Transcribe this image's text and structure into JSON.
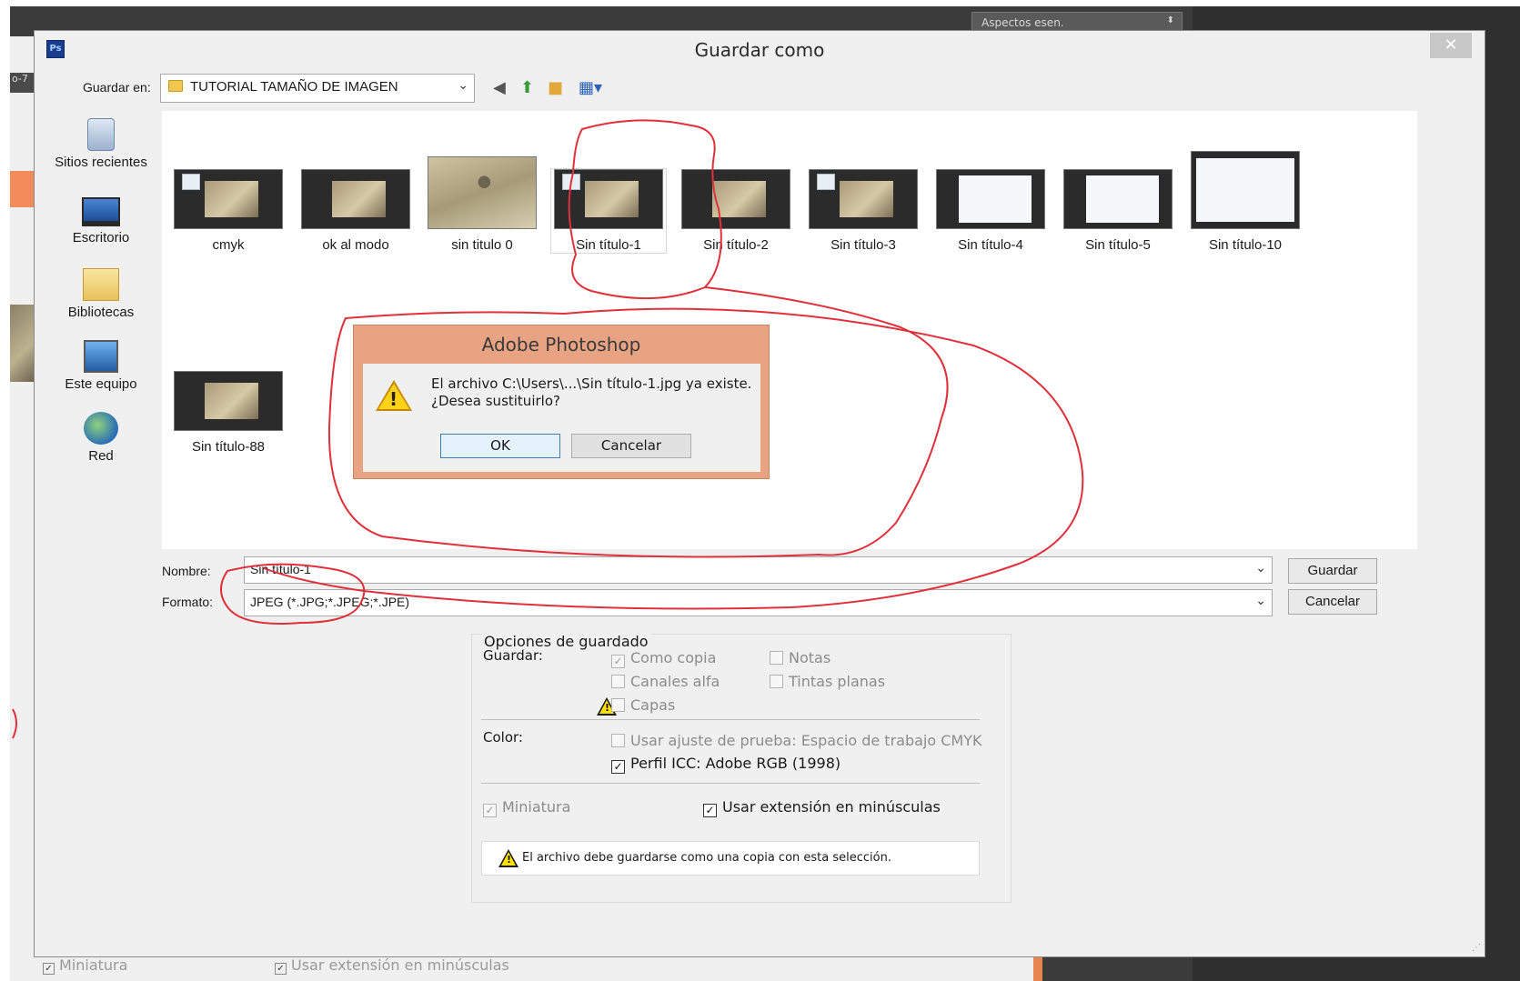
{
  "background": {
    "tab_label": "o-7",
    "top_select": "Aspectos esen.",
    "under_miniatura": "Miniatura",
    "under_extension": "Usar extensión en minúsculas"
  },
  "dialog": {
    "title": "Guardar como",
    "close_glyph": "✕",
    "save_in_label": "Guardar en:",
    "save_in_value": "TUTORIAL TAMAÑO DE IMAGEN"
  },
  "places": [
    {
      "label": "Sitios recientes",
      "icon": "recent-places-icon"
    },
    {
      "label": "Escritorio",
      "icon": "desktop-icon"
    },
    {
      "label": "Bibliotecas",
      "icon": "libraries-icon"
    },
    {
      "label": "Este equipo",
      "icon": "this-pc-icon"
    },
    {
      "label": "Red",
      "icon": "network-icon"
    }
  ],
  "files": [
    {
      "name": "cmyk"
    },
    {
      "name": "ok al modo"
    },
    {
      "name": "sin titulo 0"
    },
    {
      "name": "Sin título-1"
    },
    {
      "name": "Sin título-2"
    },
    {
      "name": "Sin título-3"
    },
    {
      "name": "Sin título-4"
    },
    {
      "name": "Sin título-5"
    },
    {
      "name": "Sin título-10"
    },
    {
      "name": "Sin título-88"
    }
  ],
  "form": {
    "name_label": "Nombre:",
    "name_value": "Sin título-1",
    "format_label": "Formato:",
    "format_value": "JPEG (*.JPG;*.JPEG;*.JPE)",
    "save_button": "Guardar",
    "cancel_button": "Cancelar"
  },
  "options": {
    "title": "Opciones de guardado",
    "save_label": "Guardar:",
    "como_copia": "Como copia",
    "notas": "Notas",
    "canales_alfa": "Canales alfa",
    "tintas_planas": "Tintas planas",
    "capas": "Capas",
    "color_label": "Color:",
    "ajuste_prueba": "Usar ajuste de prueba: Espacio de trabajo CMYK",
    "perfil_icc": "Perfil ICC: Adobe RGB (1998)",
    "miniatura": "Miniatura",
    "extension_minusculas": "Usar extensión en minúsculas",
    "warning": "El archivo debe guardarse como una copia con esta selección."
  },
  "alert": {
    "title": "Adobe Photoshop",
    "line1": "El archivo C:\\Users\\...\\Sin título-1.jpg ya existe.",
    "line2": "¿Desea sustituirlo?",
    "ok": "OK",
    "cancel": "Cancelar"
  },
  "colors": {
    "alert_frame": "#e8a382",
    "annotation_red": "#e0303a",
    "warning_yellow": "#ffd21a"
  }
}
